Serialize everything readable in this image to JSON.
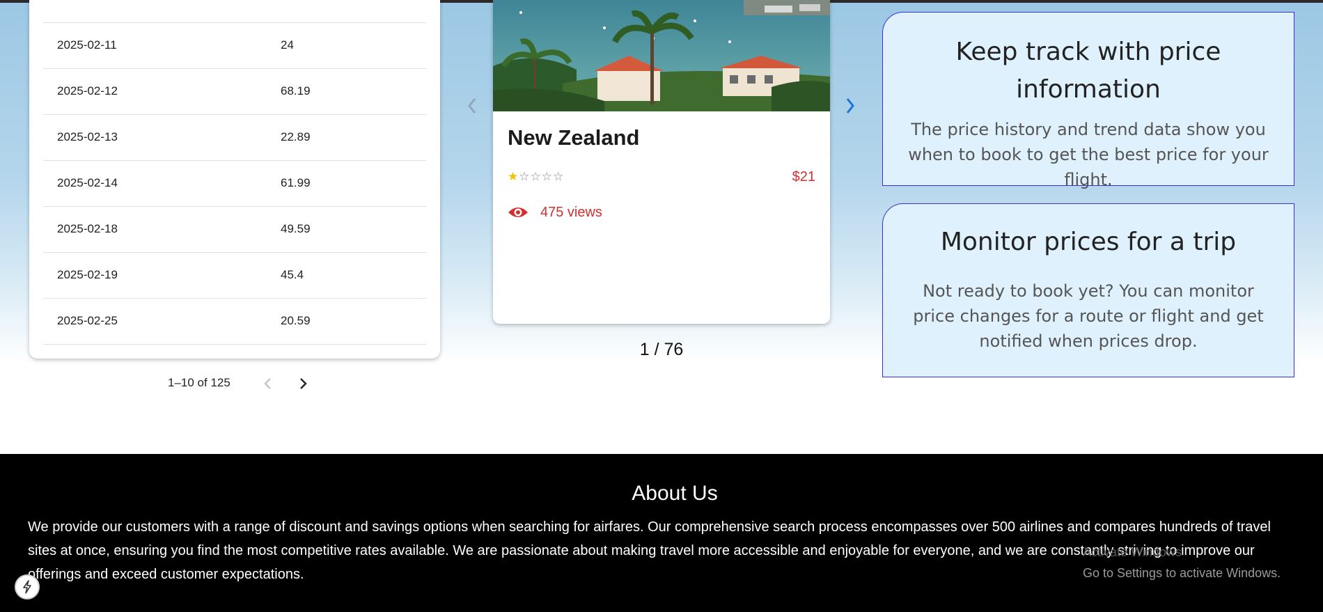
{
  "price_table": {
    "rows": [
      {
        "date": "2025-02-11",
        "price": "24"
      },
      {
        "date": "2025-02-12",
        "price": "68.19"
      },
      {
        "date": "2025-02-13",
        "price": "22.89"
      },
      {
        "date": "2025-02-14",
        "price": "61.99"
      },
      {
        "date": "2025-02-18",
        "price": "49.59"
      },
      {
        "date": "2025-02-19",
        "price": "45.4"
      },
      {
        "date": "2025-02-25",
        "price": "20.59"
      }
    ],
    "pagination_label": "1–10 of 125"
  },
  "destination_carousel": {
    "name": "New Zealand",
    "rating": 1,
    "rating_max": 5,
    "price": "$21",
    "views": "475 views",
    "counter": "1 / 76"
  },
  "features": [
    {
      "title": "Keep track with price information",
      "body": "The price history and trend data show you when to book to get the best price for your flight."
    },
    {
      "title": "Monitor prices for a trip",
      "body": "Not ready to book yet? You can monitor price changes for a route or flight and get notified when prices drop."
    }
  ],
  "footer": {
    "title": "About Us",
    "text": "We provide our customers with a range of discount and savings options when searching for airfares. Our comprehensive search process encompasses over 500 airlines and compares hundreds of travel sites at once, ensuring you find the most competitive rates available. We are passionate about making travel more accessible and enjoyable for everyone, and we are constantly striving to improve our offerings and exceed customer expectations."
  },
  "activation_watermark": {
    "line1": "Activate Windows",
    "line2": "Go to Settings to activate Windows."
  },
  "colors": {
    "accent_red": "#d32f2f",
    "arrow_blue": "#1976d2",
    "feature_border": "#3b2fd1",
    "feature_bg": "#dff1fc"
  }
}
